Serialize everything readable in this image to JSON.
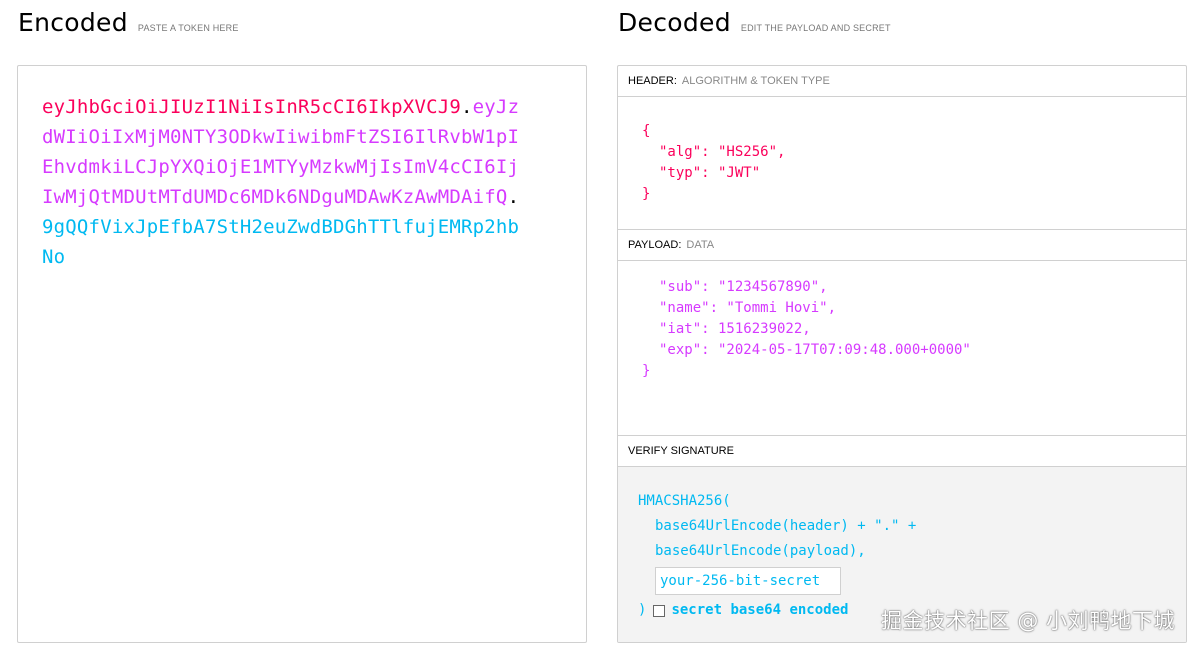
{
  "encoded": {
    "title": "Encoded",
    "subtitle": "PASTE A TOKEN HERE",
    "token": {
      "header": "eyJhbGciOiJIUzI1NiIsInR5cCI6IkpXVCJ9",
      "payload": "eyJzdWIiOiIxMjM0NTY3ODkwIiwibmFtZSI6IlRvbW1pIEhvdmkiLCJpYXQiOjE1MTYyMzkwMjIsImV4cCI6IjIwMjQtMDUtMTdUMDc6MDk6NDguMDAwKzAwMDAifQ",
      "signature": "9gQQfVixJpEfbA7StH2euZwdBDGhTTlfujEMRp2hbNo",
      "dot": "."
    }
  },
  "decoded": {
    "title": "Decoded",
    "subtitle": "EDIT THE PAYLOAD AND SECRET",
    "header_section": {
      "label": "HEADER:",
      "sublabel": "ALGORITHM & TOKEN TYPE",
      "lines": [
        "{",
        "\"alg\": \"HS256\",",
        "\"typ\": \"JWT\"",
        "}"
      ]
    },
    "payload_section": {
      "label": "PAYLOAD:",
      "sublabel": "DATA",
      "lines": [
        "\"sub\": \"1234567890\",",
        "\"name\": \"Tommi Hovi\",",
        "\"iat\": 1516239022,",
        "\"exp\": \"2024-05-17T07:09:48.000+0000\"",
        "}"
      ]
    },
    "signature_section": {
      "label": "VERIFY SIGNATURE",
      "func_open": "HMACSHA256(",
      "line1": "base64UrlEncode(header) + \".\" +",
      "line2": "base64UrlEncode(payload),",
      "secret_placeholder": "your-256-bit-secret",
      "func_close": ")",
      "checkbox_label": "secret base64 encoded"
    }
  },
  "watermark": "掘金技术社区 @ 小刘鸭地下城",
  "colors": {
    "header": "#fb015b",
    "payload": "#d63aff",
    "signature": "#00b9f1"
  }
}
